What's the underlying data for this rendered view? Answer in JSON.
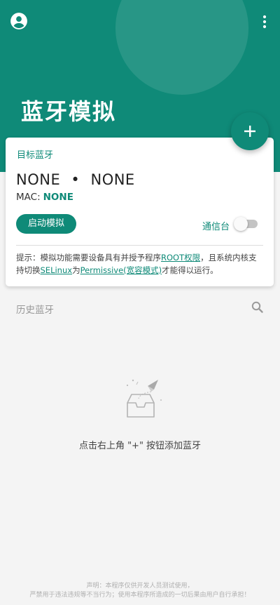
{
  "app": {
    "title": "蓝牙模拟"
  },
  "header": {
    "accent_color": "#0f8a78",
    "icons": [
      "account-circle-icon",
      "more-vert-icon",
      "add-icon"
    ]
  },
  "target_card": {
    "label": "目标蓝牙",
    "device_name": "NONE",
    "separator": "•",
    "device_type": "NONE",
    "mac_label": "MAC:",
    "mac_value": "NONE",
    "start_button": "启动模拟",
    "console_label": "通信台",
    "console_enabled": false,
    "tip": {
      "p1": "提示：模拟功能需要设备具有并授予程序",
      "root_link": "ROOT权限",
      "p2": "，且系统内核支持切换",
      "selinux_link": "SELinux",
      "p3": "为",
      "permissive_link": "Permissive(宽容模式)",
      "p4": "才能得以运行。"
    }
  },
  "history": {
    "title": "历史蓝牙",
    "empty_text": "点击右上角 \"+\" 按钮添加蓝牙"
  },
  "footer": {
    "line1": "声明：本程序仅供开发人员测试使用，",
    "line2": "严禁用于违法违规等不当行为；使用本程序所造成的一切后果由用户自行承担！"
  }
}
